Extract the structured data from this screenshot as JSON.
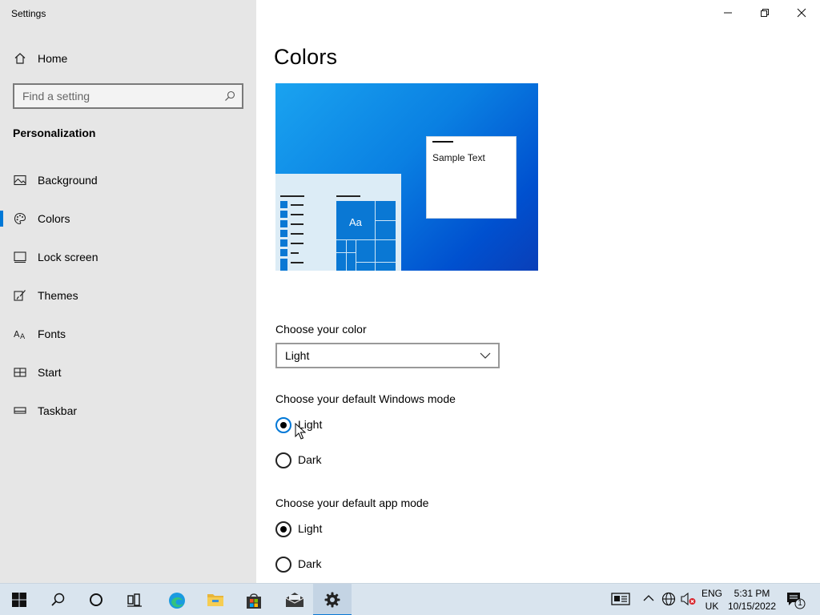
{
  "app": {
    "title": "Settings"
  },
  "sidebar": {
    "home_label": "Home",
    "search_placeholder": "Find a setting",
    "section_title": "Personalization",
    "items": [
      {
        "label": "Background",
        "icon": "picture-icon"
      },
      {
        "label": "Colors",
        "icon": "palette-icon",
        "active": true
      },
      {
        "label": "Lock screen",
        "icon": "lock-screen-icon"
      },
      {
        "label": "Themes",
        "icon": "brush-icon"
      },
      {
        "label": "Fonts",
        "icon": "font-icon"
      },
      {
        "label": "Start",
        "icon": "start-icon"
      },
      {
        "label": "Taskbar",
        "icon": "taskbar-icon"
      }
    ]
  },
  "main": {
    "title": "Colors",
    "preview": {
      "sample_text": "Sample Text",
      "tile_text": "Aa"
    },
    "choose_color": {
      "label": "Choose your color",
      "selected": "Light"
    },
    "windows_mode": {
      "label": "Choose your default Windows mode",
      "options": [
        {
          "label": "Light",
          "checked": true
        },
        {
          "label": "Dark",
          "checked": false
        }
      ]
    },
    "app_mode": {
      "label": "Choose your default app mode",
      "options": [
        {
          "label": "Light",
          "checked": true
        },
        {
          "label": "Dark",
          "checked": false
        }
      ]
    }
  },
  "taskbar": {
    "language": {
      "line1": "ENG",
      "line2": "UK"
    },
    "clock": {
      "time": "5:31 PM",
      "date": "10/15/2022"
    },
    "notification_count": "1"
  },
  "colors": {
    "accent": "#0078d7",
    "sidebar_bg": "#e6e6e6",
    "taskbar_bg": "#d9e4ee"
  }
}
